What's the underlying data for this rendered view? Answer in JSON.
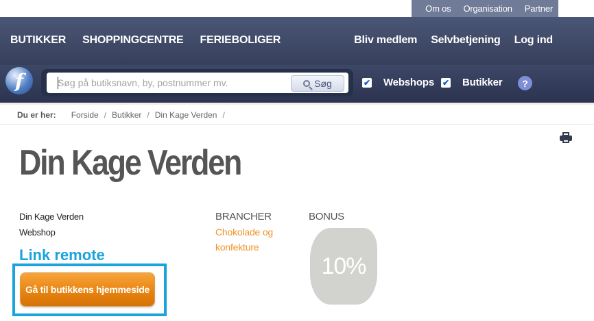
{
  "top_links": [
    "Om os",
    "Organisation",
    "Partner"
  ],
  "nav": {
    "left": [
      "BUTIKKER",
      "SHOPPINGCENTRE",
      "FERIEBOLIGER"
    ],
    "right": [
      "Bliv medlem",
      "Selvbetjening",
      "Log ind"
    ]
  },
  "search": {
    "placeholder": "Søg på butiksnavn, by, postnummer mv.",
    "button_label": "Søg",
    "filters": [
      {
        "label": "Webshops",
        "checked": true
      },
      {
        "label": "Butikker",
        "checked": true
      }
    ],
    "help_label": "?"
  },
  "breadcrumb": {
    "label": "Du er her:",
    "items": [
      "Forside",
      "Butikker",
      "Din Kage Verden"
    ],
    "separator": "/"
  },
  "store": {
    "title": "Din Kage Verden",
    "name": "Din Kage Verden",
    "type": "Webshop",
    "link_remote_label": "Link remote",
    "homepage_button": "Gå til butikkens hjemmeside"
  },
  "brancher": {
    "heading": "BRANCHER",
    "items": [
      "Chokolade og",
      "konfekture"
    ]
  },
  "bonus": {
    "heading": "BONUS",
    "value": "10%"
  },
  "colors": {
    "nav_bg": "#3f4a6a",
    "accent_orange": "#f0932a",
    "highlight_blue": "#1aa3dd",
    "bonus_badge": "#d2d2ce"
  },
  "icons": [
    "logo-icon",
    "search-icon",
    "help-icon",
    "print-icon",
    "checkbox-check-icon"
  ]
}
